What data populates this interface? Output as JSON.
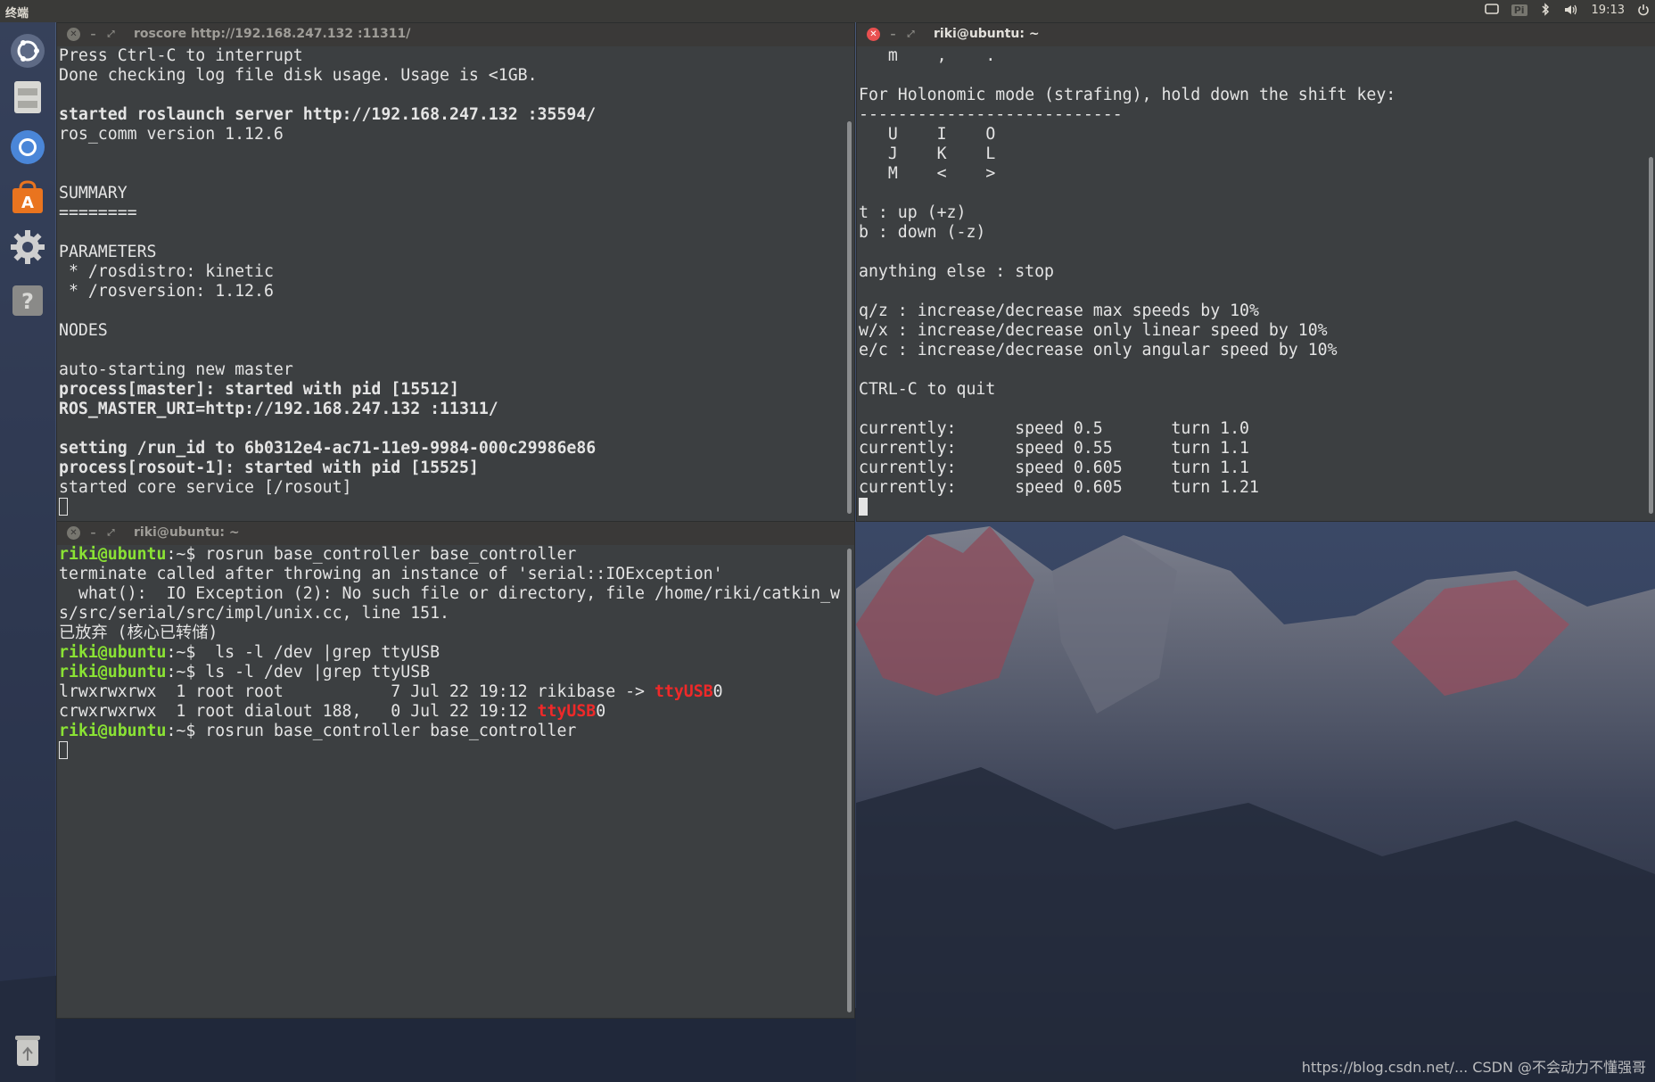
{
  "top_panel": {
    "app_title": "终端",
    "keyboard_indicator": "Pi",
    "clock": "19:13"
  },
  "terminals": {
    "roscore": {
      "title": "roscore http://192.168.247.132 :11311/",
      "lines": [
        {
          "text": "Press Ctrl-C to interrupt"
        },
        {
          "text": "Done checking log file disk usage. Usage is <1GB."
        },
        {
          "text": ""
        },
        {
          "text": "started roslaunch server http://192.168.247.132 :35594/",
          "bold": true
        },
        {
          "text": "ros_comm version 1.12.6"
        },
        {
          "text": ""
        },
        {
          "text": ""
        },
        {
          "text": "SUMMARY"
        },
        {
          "text": "========"
        },
        {
          "text": ""
        },
        {
          "text": "PARAMETERS"
        },
        {
          "text": " * /rosdistro: kinetic"
        },
        {
          "text": " * /rosversion: 1.12.6"
        },
        {
          "text": ""
        },
        {
          "text": "NODES"
        },
        {
          "text": ""
        },
        {
          "text": "auto-starting new master"
        },
        {
          "text": "process[master]: started with pid [15512]",
          "bold": true
        },
        {
          "text": "ROS_MASTER_URI=http://192.168.247.132 :11311/",
          "bold": true
        },
        {
          "text": ""
        },
        {
          "text": "setting /run_id to 6b0312e4-ac71-11e9-9984-000c29986e86",
          "bold": true
        },
        {
          "text": "process[rosout-1]: started with pid [15525]",
          "bold": true
        },
        {
          "text": "started core service [/rosout]"
        }
      ]
    },
    "teleop": {
      "title": "riki@ubuntu: ~",
      "lines": [
        {
          "text": "   m    ,    ."
        },
        {
          "text": ""
        },
        {
          "text": "For Holonomic mode (strafing), hold down the shift key:"
        },
        {
          "text": "---------------------------"
        },
        {
          "text": "   U    I    O"
        },
        {
          "text": "   J    K    L"
        },
        {
          "text": "   M    <    >"
        },
        {
          "text": ""
        },
        {
          "text": "t : up (+z)"
        },
        {
          "text": "b : down (-z)"
        },
        {
          "text": ""
        },
        {
          "text": "anything else : stop"
        },
        {
          "text": ""
        },
        {
          "text": "q/z : increase/decrease max speeds by 10%"
        },
        {
          "text": "w/x : increase/decrease only linear speed by 10%"
        },
        {
          "text": "e/c : increase/decrease only angular speed by 10%"
        },
        {
          "text": ""
        },
        {
          "text": "CTRL-C to quit"
        },
        {
          "text": ""
        },
        {
          "text": "currently:      speed 0.5       turn 1.0"
        },
        {
          "text": "currently:      speed 0.55      turn 1.1"
        },
        {
          "text": "currently:      speed 0.605     turn 1.1"
        },
        {
          "text": "currently:      speed 0.605     turn 1.21"
        }
      ]
    },
    "shell": {
      "title": "riki@ubuntu: ~",
      "lines": [
        {
          "segments": [
            {
              "text": "riki@ubuntu",
              "style": "green"
            },
            {
              "text": ":~$ rosrun base_controller base_controller"
            }
          ]
        },
        {
          "segments": [
            {
              "text": "terminate called after throwing an instance of 'serial::IOException'"
            }
          ]
        },
        {
          "segments": [
            {
              "text": "  what():  IO Exception (2): No such file or directory, file /home/riki/catkin_w"
            }
          ]
        },
        {
          "segments": [
            {
              "text": "s/src/serial/src/impl/unix.cc, line 151."
            }
          ]
        },
        {
          "segments": [
            {
              "text": "已放弃 (核心已转储)"
            }
          ]
        },
        {
          "segments": [
            {
              "text": "riki@ubuntu",
              "style": "green"
            },
            {
              "text": ":~$  ls -l /dev |grep ttyUSB"
            }
          ]
        },
        {
          "segments": [
            {
              "text": "riki@ubuntu",
              "style": "green"
            },
            {
              "text": ":~$ ls -l /dev |grep ttyUSB"
            }
          ]
        },
        {
          "segments": [
            {
              "text": "lrwxrwxrwx  1 root root           7 Jul 22 19:12 rikibase -> "
            },
            {
              "text": "ttyUSB",
              "style": "red"
            },
            {
              "text": "0"
            }
          ]
        },
        {
          "segments": [
            {
              "text": "crwxrwxrwx  1 root dialout 188,   0 Jul 22 19:12 "
            },
            {
              "text": "ttyUSB",
              "style": "red"
            },
            {
              "text": "0"
            }
          ]
        },
        {
          "segments": [
            {
              "text": "riki@ubuntu",
              "style": "green"
            },
            {
              "text": ":~$ rosrun base_controller base_controller"
            }
          ]
        }
      ]
    }
  },
  "launcher": {
    "items": [
      "ubuntu-dash-icon",
      "file-manager-icon",
      "chromium-icon",
      "software-center-icon",
      "system-settings-icon",
      "help-icon",
      "trash-icon"
    ]
  },
  "watermark": "https://blog.csdn.net/... CSDN @不会动力不懂强哥"
}
